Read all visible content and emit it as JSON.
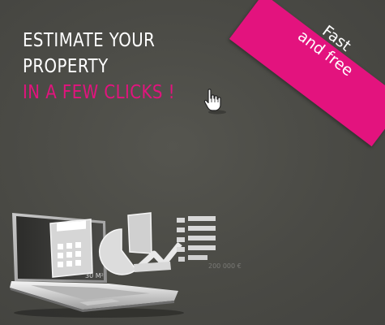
{
  "headline": {
    "line1": "ESTIMATE YOUR",
    "line2": "PROPERTY",
    "line3": "IN A FEW CLICKS !"
  },
  "ribbon": {
    "line1": "Fast",
    "line2": "and free"
  },
  "illustration": {
    "screen_area": "30 M²",
    "screen_price": "200 000 €"
  },
  "colors": {
    "background": "#4a4a45",
    "accent": "#e3137e",
    "text": "#ffffff"
  },
  "icons": [
    "hand-pointer-icon",
    "laptop-icon",
    "calculator-icon",
    "pie-chart-icon",
    "line-chart-icon",
    "list-icon"
  ]
}
